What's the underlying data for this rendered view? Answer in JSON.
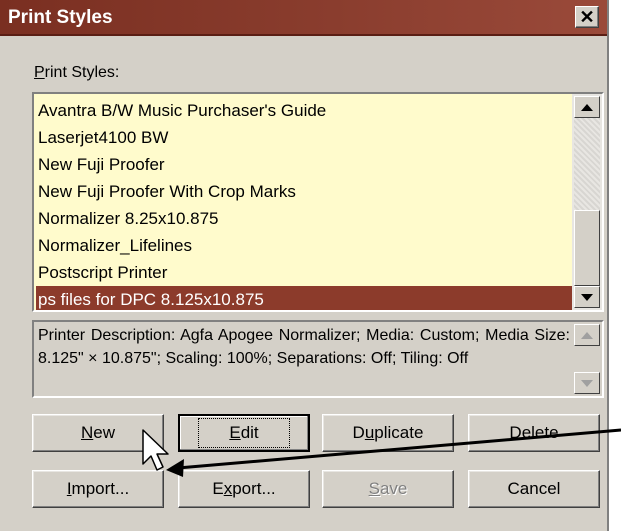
{
  "window": {
    "title": "Print Styles",
    "close_icon": "close-icon"
  },
  "print_styles": {
    "label_prefix": "P",
    "label_rest": "rint Styles:",
    "items": [
      {
        "label": "Avantra B/W Music Purchaser's Guide",
        "selected": false
      },
      {
        "label": "Laserjet4100 BW",
        "selected": false
      },
      {
        "label": "New Fuji Proofer",
        "selected": false
      },
      {
        "label": "New Fuji Proofer With Crop Marks",
        "selected": false
      },
      {
        "label": "Normalizer 8.25x10.875",
        "selected": false
      },
      {
        "label": "Normalizer_Lifelines",
        "selected": false
      },
      {
        "label": "Postscript Printer",
        "selected": false
      },
      {
        "label": "ps files for DPC 8.125x10.875",
        "selected": true
      }
    ],
    "scroll_position": 0.85
  },
  "description": {
    "text": "Printer Description: Agfa Apogee Normalizer;  Media: Custom;  Media Size: 8.125\" × 10.875\";  Scaling: 100%;  Separations: Off;  Tiling: Off"
  },
  "buttons": {
    "new": {
      "u": "N",
      "rest": "ew"
    },
    "edit": {
      "u": "E",
      "rest": "dit"
    },
    "duplicate": {
      "pre": "D",
      "u": "u",
      "rest": "plicate"
    },
    "delete": {
      "u": "D",
      "rest": "elete"
    },
    "import": {
      "u": "I",
      "rest": "mport..."
    },
    "export": {
      "pre": "E",
      "u": "x",
      "rest": "port..."
    },
    "save": {
      "u": "S",
      "rest": "ave",
      "enabled": false
    },
    "cancel": {
      "label": "Cancel"
    }
  },
  "colors": {
    "title_bar": "#8a3d2e",
    "list_background": "#fffbcc",
    "selection": "#8c3b2b",
    "dialog_face": "#d4d0c8"
  }
}
